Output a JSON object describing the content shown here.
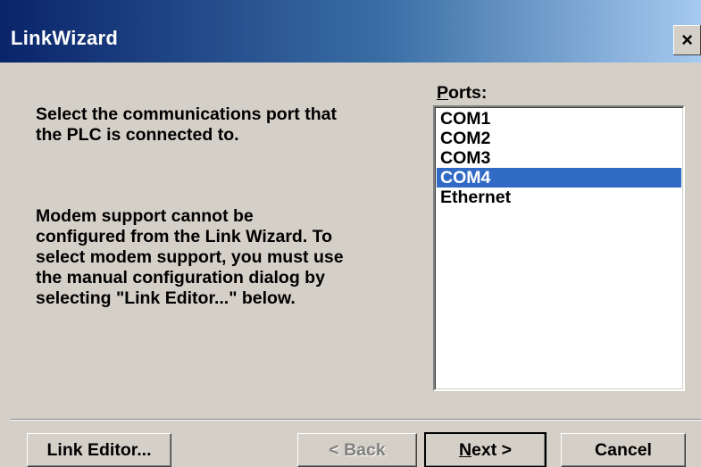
{
  "window": {
    "title": "LinkWizard",
    "close_glyph": "×"
  },
  "instructions": {
    "select_port": "Select the communications port that\nthe PLC is connected to.",
    "modem_note": "Modem support cannot be\nconfigured from the Link Wizard. To\nselect modem support, you must use\nthe manual configuration dialog by\nselecting \"Link Editor...\" below."
  },
  "ports": {
    "label_accel": "P",
    "label_rest": "orts:",
    "items": [
      "COM1",
      "COM2",
      "COM3",
      "COM4",
      "Ethernet"
    ],
    "selected": "COM4"
  },
  "buttons": {
    "link_editor": "Link Editor...",
    "back": "< Back",
    "next_accel": "N",
    "next_rest": "ext >",
    "cancel": "Cancel"
  },
  "colors": {
    "selection": "#316ac5",
    "face": "#d4d0c8",
    "title_start": "#0a246a",
    "title_end": "#a6caf0"
  }
}
